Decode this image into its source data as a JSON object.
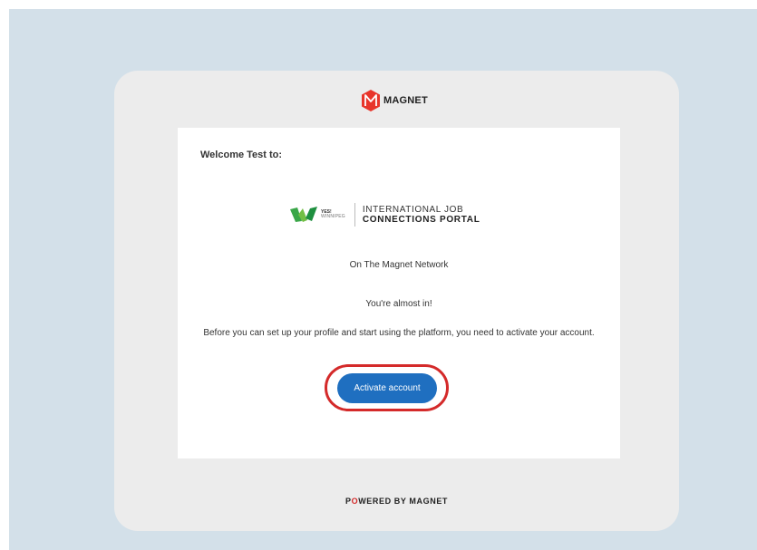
{
  "brand": {
    "name": "MAGNET",
    "accent_color": "#e8352b",
    "icon": "magnet-m-logo-icon"
  },
  "email": {
    "welcome": "Welcome Test to:",
    "partner": {
      "icon": "yes-winnipeg-logo-icon",
      "yes_text": "YES!",
      "winnipeg_text": "WINNIPEG",
      "portal_line1": "INTERNATIONAL JOB",
      "portal_line2": "CONNECTIONS PORTAL"
    },
    "network_text": "On The Magnet Network",
    "almost_text": "You're almost in!",
    "instructions": "Before you can set up your profile and start using the platform, you need to activate your account.",
    "cta_label": "Activate account",
    "cta_color": "#1f6fc0",
    "highlight_color": "#d42a2a"
  },
  "footer": {
    "powered_prefix": "P",
    "powered_o": "O",
    "powered_suffix": "WERED BY MAGNET"
  }
}
